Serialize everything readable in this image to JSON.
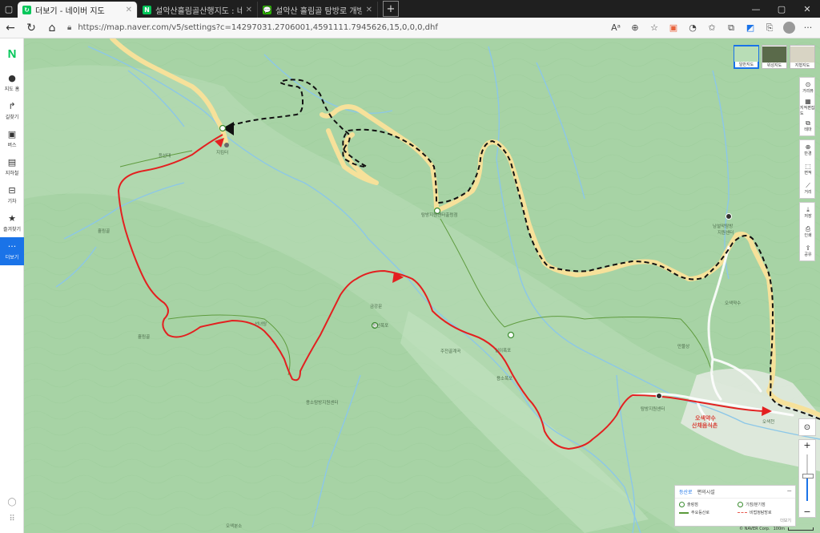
{
  "tabs": [
    {
      "title": "더보기 - 네이버 지도",
      "fav_color": "#03c75a",
      "fav_glyph": "↻",
      "active": true
    },
    {
      "title": "설악산흘림골산행지도 : 네이버",
      "fav_color": "#03c75a",
      "fav_glyph": "N",
      "active": false
    },
    {
      "title": "설악산 흘림골 탐방로 개방 운영",
      "fav_color": "#2db400",
      "fav_glyph": "💬",
      "active": false
    }
  ],
  "address": {
    "url": "https://map.naver.com/v5/settings?c=14297031.2706001,4591111.7945626,15,0,0,0,dhf"
  },
  "sidebar": {
    "logo": "N",
    "items": [
      {
        "icon": "●",
        "label": "지도 홈"
      },
      {
        "icon": "↱",
        "label": "길찾기"
      },
      {
        "icon": "▣",
        "label": "버스"
      },
      {
        "icon": "▤",
        "label": "지하철"
      },
      {
        "icon": "⊟",
        "label": "기차"
      },
      {
        "icon": "★",
        "label": "즐겨찾기"
      },
      {
        "icon": "···",
        "label": "더보기"
      }
    ]
  },
  "maptypes": [
    {
      "label": "일반지도",
      "color": "#b8ddb6",
      "active": true
    },
    {
      "label": "위성지도",
      "color": "#5a6a4a",
      "active": false
    },
    {
      "label": "지형지도",
      "color": "#d8d4c4",
      "active": false
    }
  ],
  "toolbar": {
    "group1": [
      {
        "icon": "⊙",
        "label": "거리뷰"
      },
      {
        "icon": "▦",
        "label": "지적편집도"
      },
      {
        "icon": "⧉",
        "label": "테마"
      }
    ],
    "group2": [
      {
        "icon": "⊕",
        "label": "반경"
      },
      {
        "icon": "⬚",
        "label": "면적"
      },
      {
        "icon": "⟋",
        "label": "거리"
      }
    ],
    "group3": [
      {
        "icon": "⤓",
        "label": "저장"
      },
      {
        "icon": "⎙",
        "label": "인쇄"
      },
      {
        "icon": "⇪",
        "label": "공유"
      }
    ]
  },
  "zoom": {
    "plus": "+",
    "minus": "−",
    "level": 0.55
  },
  "legend": {
    "tabs": [
      "등산로",
      "편의시설"
    ],
    "items": [
      {
        "kind": "circle",
        "label": "출렁점"
      },
      {
        "kind": "circle",
        "label": "기점/분기점"
      },
      {
        "kind": "line",
        "label": "주요등산로"
      },
      {
        "kind": "dashed",
        "label": "비법정탐방로"
      }
    ],
    "more": "더보기",
    "close": "−"
  },
  "scale": {
    "attribution": "© NAVER Corp.",
    "text": "100m"
  },
  "map_labels": [
    {
      "text": "지킴터",
      "color": "#4b6b4b"
    },
    {
      "text": "등선대",
      "color": "#4b6b4b"
    },
    {
      "text": "흘림골",
      "color": "#4b6b4b"
    },
    {
      "text": "탐방지원센터출렁점",
      "color": "#4b6b4b"
    },
    {
      "text": "금강문",
      "color": "#4b6b4b"
    },
    {
      "text": "등선폭포",
      "color": "#4b6b4b"
    },
    {
      "text": "흘림골",
      "color": "#4b6b4b"
    },
    {
      "text": "선녀탕",
      "color": "#4b6b4b"
    },
    {
      "text": "주전골계곡",
      "color": "#4b6b4b"
    },
    {
      "text": "용소폭포",
      "color": "#4b6b4b"
    },
    {
      "text": "십이폭포",
      "color": "#4b6b4b"
    },
    {
      "text": "용소탐방지원센터",
      "color": "#4b6b4b"
    },
    {
      "text": "오색분소",
      "color": "#4b6b4b"
    },
    {
      "text": "남설악탐방",
      "color": "#4b6b4b"
    },
    {
      "text": "지원센터",
      "color": "#4b6b4b"
    },
    {
      "text": "오색약수",
      "color": "#4b6b4b"
    },
    {
      "text": "탐방지원센터",
      "color": "#4b6b4b"
    },
    {
      "text": "오색약수",
      "color": "#d9433a"
    },
    {
      "text": "산채음식촌",
      "color": "#d9433a"
    },
    {
      "text": "오색천",
      "color": "#4b6b4b"
    },
    {
      "text": "만물상",
      "color": "#4b6b4b"
    }
  ]
}
